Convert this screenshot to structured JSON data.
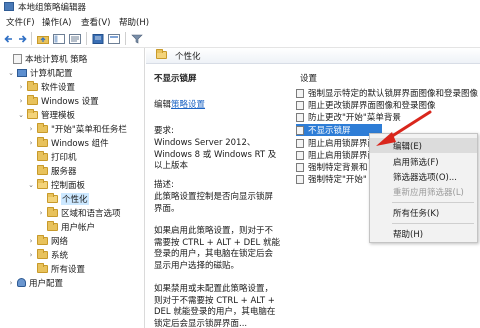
{
  "window": {
    "title": "本地组策略编辑器"
  },
  "menubar": [
    "文件(F)",
    "操作(A)",
    "查看(V)",
    "帮助(H)"
  ],
  "colors": {
    "selection": "#2e7dd6",
    "tree_selection": "#cce8ff",
    "link": "#1b63c4",
    "arrow": "#d9261c"
  },
  "tree": {
    "root": "本地计算机 策略",
    "computer_config": "计算机配置",
    "software_settings": "软件设置",
    "windows_settings": "Windows 设置",
    "admin_templates": "管理模板",
    "start_menu_taskbar": "\"开始\"菜单和任务栏",
    "windows_components": "Windows 组件",
    "printers": "打印机",
    "server": "服务器",
    "control_panel": "控制面板",
    "personalization": "个性化",
    "region_language": "区域和语言选项",
    "user_accounts": "用户帐户",
    "network": "网络",
    "system": "系统",
    "all_settings": "所有设置",
    "user_config": "用户配置"
  },
  "header": {
    "title": "个性化"
  },
  "description": {
    "policy_title": "不显示锁屏",
    "edit_prefix": "编辑",
    "edit_link": "策略设置",
    "requirements_label": "要求:",
    "requirements_text": "Windows Server 2012、Windows 8 或 Windows RT 及以上版本",
    "desc_label": "描述:",
    "desc_text": "此策略设置控制是否向显示锁屏界面。",
    "para1": "如果启用此策略设置，则对于不需要按 CTRL + ALT + DEL 就能登录的用户，其电脑在锁定后会显示用户选择的磁贴。",
    "para2": "如果禁用或未配置此策略设置，则对于不需要按 CTRL + ALT + DEL 就能登录的用户，其电脑在锁定后会显示锁屏界面..."
  },
  "settings_list": {
    "column_header": "设置",
    "items": [
      "强制显示特定的默认锁屏界面图像和登录图像",
      "阻止更改锁屏界面图像和登录图像",
      "防止更改\"开始\"菜单背景",
      "不显示锁屏",
      "阻止启用锁屏界面",
      "阻止启用锁屏界面",
      "强制特定背景和",
      "强制特定\"开始\""
    ],
    "selected_index": 3
  },
  "context_menu": {
    "items": [
      {
        "label": "编辑(E)",
        "disabled": false
      },
      {
        "label": "启用筛选(F)",
        "disabled": false
      },
      {
        "label": "筛选器选项(O)...",
        "disabled": false
      },
      {
        "label": "重新应用筛选器(L)",
        "disabled": true
      },
      {
        "label": "所有任务(K)",
        "disabled": false
      },
      {
        "label": "帮助(H)",
        "disabled": false
      }
    ]
  }
}
